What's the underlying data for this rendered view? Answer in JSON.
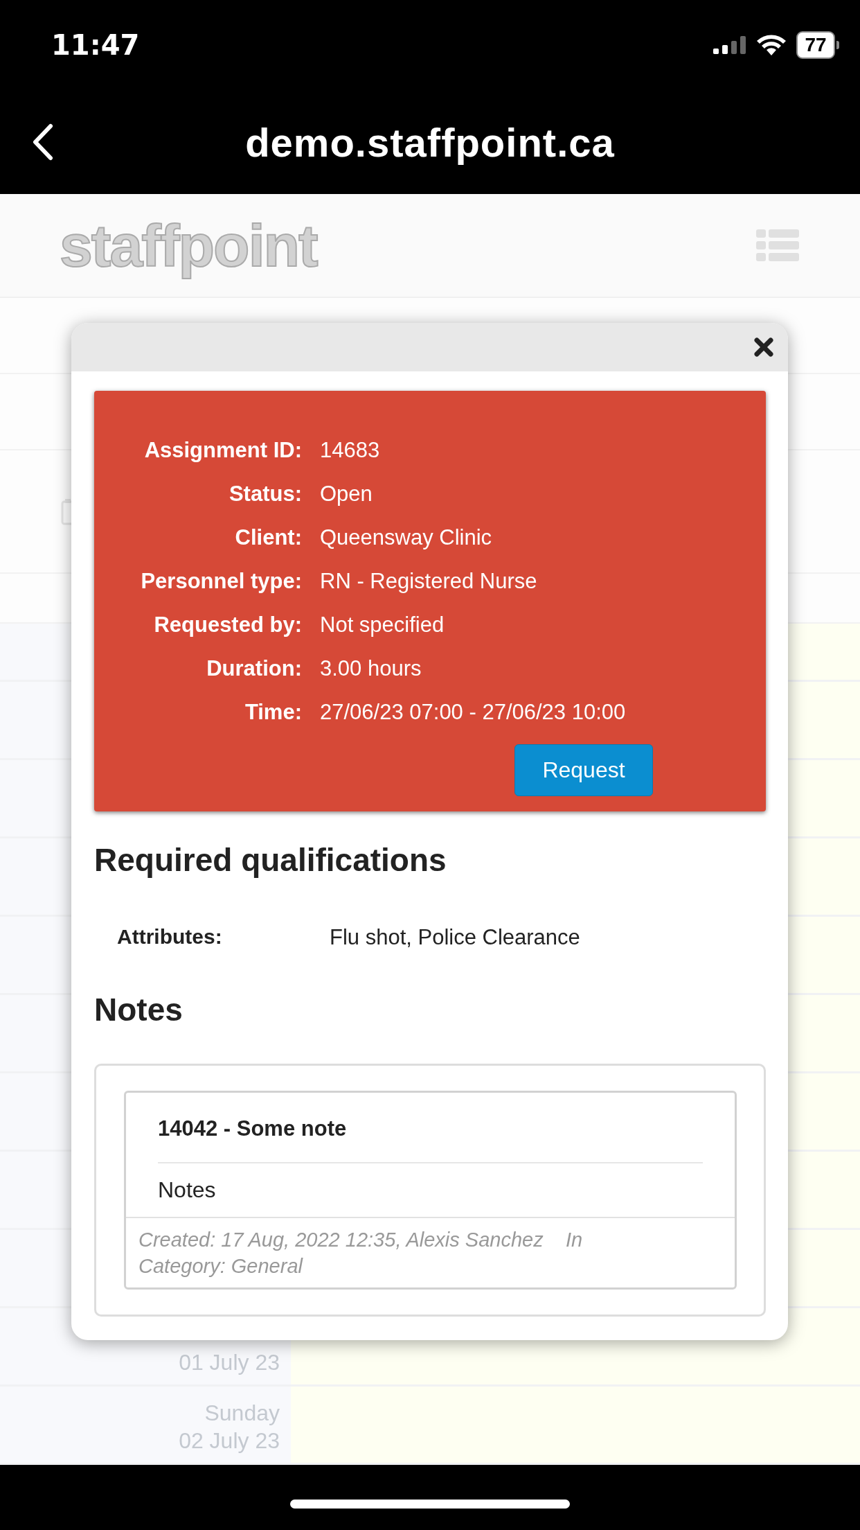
{
  "status_bar": {
    "time": "11:47",
    "battery": "77"
  },
  "nav": {
    "title": "demo.staffpoint.ca"
  },
  "app": {
    "logo": "staffpoint",
    "menu_rows": [
      {
        "kind": "blank"
      },
      {
        "kind": "blank"
      },
      {
        "kind": "icon"
      }
    ],
    "calendar_rows": [
      {},
      {},
      {},
      {},
      {},
      {},
      {},
      {},
      {},
      {
        "date": "01 July 23"
      },
      {
        "day": "Sunday",
        "date": "02 July 23"
      }
    ]
  },
  "modal": {
    "details": [
      {
        "label": "Assignment ID:",
        "value": "14683"
      },
      {
        "label": "Status:",
        "value": "Open"
      },
      {
        "label": "Client:",
        "value": "Queensway Clinic"
      },
      {
        "label": "Personnel type:",
        "value": "RN - Registered Nurse"
      },
      {
        "label": "Requested by:",
        "value": "Not specified"
      },
      {
        "label": "Duration:",
        "value": "3.00 hours"
      },
      {
        "label": "Time:",
        "value": "27/06/23 07:00 - 27/06/23 10:00"
      }
    ],
    "request_button": "Request",
    "qualifications_heading": "Required qualifications",
    "qualifications": [
      {
        "label": "Attributes:",
        "value": "Flu shot, Police Clearance"
      }
    ],
    "notes_heading": "Notes",
    "notes": [
      {
        "title": "14042 - Some note",
        "body": "Notes",
        "footer": "Created: 17 Aug, 2022 12:35, Alexis Sanchez    In Category: General"
      }
    ]
  }
}
